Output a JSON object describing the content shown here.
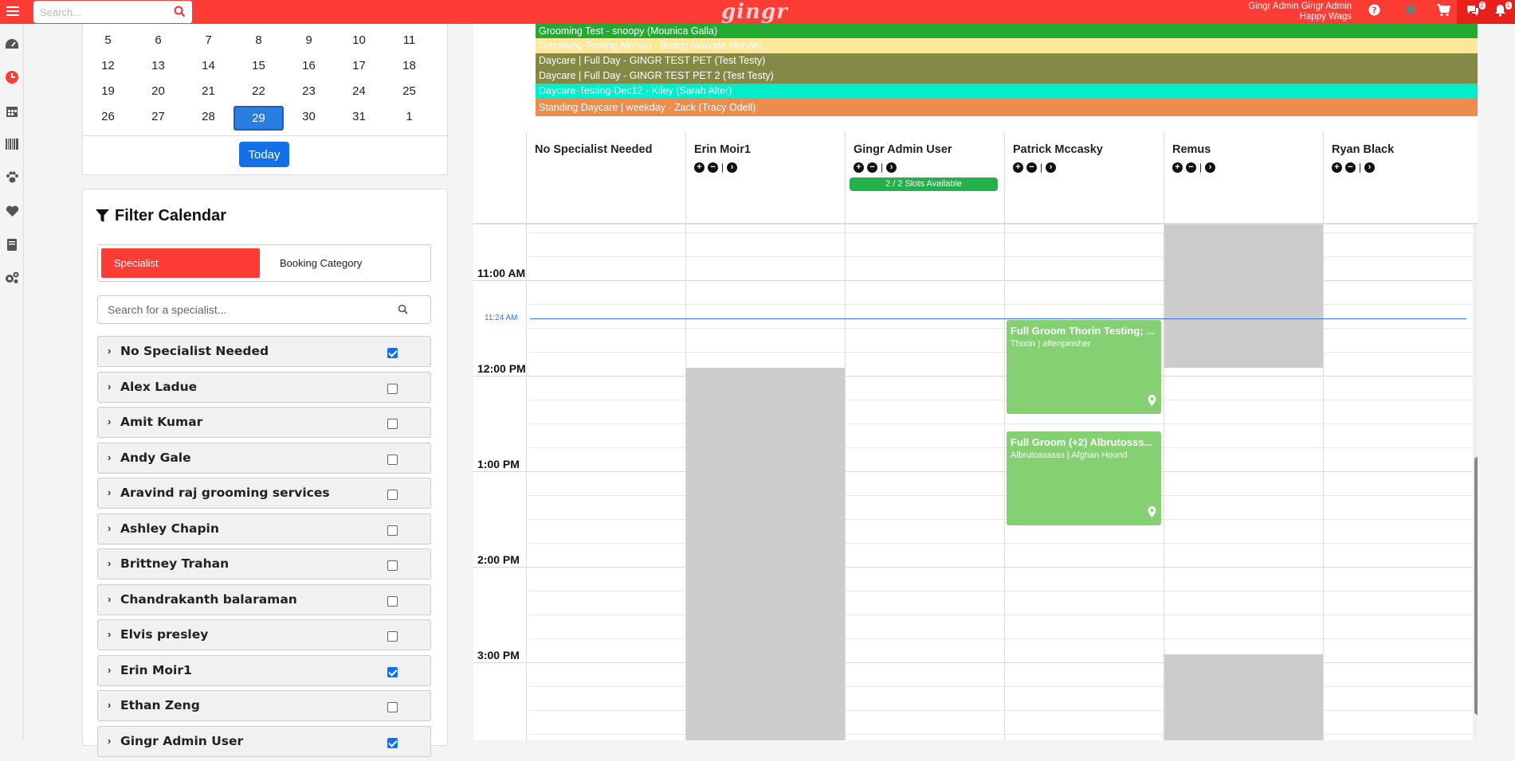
{
  "topbar": {
    "search_placeholder": "Search...",
    "logo": "gingr",
    "user_line1": "Gingr Admin Gingr Admin",
    "user_line2": "Happy Wags",
    "chat_badge": "2",
    "notif_badge": "1",
    "colors": {
      "bar": "#ff3b36"
    }
  },
  "mini_calendar": {
    "rows": [
      [
        "5",
        "6",
        "7",
        "8",
        "9",
        "10",
        "11"
      ],
      [
        "12",
        "13",
        "14",
        "15",
        "16",
        "17",
        "18"
      ],
      [
        "19",
        "20",
        "21",
        "22",
        "23",
        "24",
        "25"
      ],
      [
        "26",
        "27",
        "28",
        "29",
        "30",
        "31",
        "1"
      ]
    ],
    "selected_day": "29",
    "today_button": "Today"
  },
  "filter": {
    "title": "Filter Calendar",
    "tabs": [
      "Specialist",
      "Booking Category"
    ],
    "active_tab": "Specialist",
    "search_placeholder": "Search for a specialist...",
    "specialists": [
      {
        "name": "No Specialist Needed",
        "checked": true
      },
      {
        "name": "Alex Ladue",
        "checked": false
      },
      {
        "name": "Amit Kumar",
        "checked": false
      },
      {
        "name": "Andy Gale",
        "checked": false
      },
      {
        "name": "Aravind raj grooming services",
        "checked": false
      },
      {
        "name": "Ashley Chapin",
        "checked": false
      },
      {
        "name": "Brittney Trahan",
        "checked": false
      },
      {
        "name": "Chandrakanth balaraman",
        "checked": false
      },
      {
        "name": "Elvis presley",
        "checked": false
      },
      {
        "name": "Erin Moir1",
        "checked": true
      },
      {
        "name": "Ethan Zeng",
        "checked": false
      },
      {
        "name": "Gingr Admin User",
        "checked": true
      }
    ]
  },
  "all_day_bars": [
    {
      "label": "Grooming Test - snoopy (Mounica Galla)",
      "color": "#22aa33"
    },
    {
      "label": "Grooming-Testing-Mohan - Buddy (alavala Mohan)",
      "color": "#ffe79a",
      "text_color": "#ffffff"
    },
    {
      "label": "Daycare | Full Day - GINGR TEST PET (Test Testy)",
      "color": "#848a45"
    },
    {
      "label": "Daycare | Full Day - GINGR TEST PET 2 (Test Testy)",
      "color": "#848a45"
    },
    {
      "label": "Daycare-Testing-Dec12 - Kiley (Sarah Alter)",
      "color": "#00eecb"
    },
    {
      "label": "Standing Daycare | weekday - Zack (Tracy Odell)",
      "color": "#ec8d4e"
    }
  ],
  "columns": [
    {
      "name": "No Specialist Needed",
      "controls": false
    },
    {
      "name": "Erin Moir1",
      "controls": true
    },
    {
      "name": "Gingr Admin User",
      "controls": true,
      "slots": "2 / 2 Slots Available"
    },
    {
      "name": "Patrick Mccasky",
      "controls": true
    },
    {
      "name": "Remus",
      "controls": true
    },
    {
      "name": "Ryan Black",
      "controls": true
    }
  ],
  "time_labels": [
    "11:00 AM",
    "12:00 PM",
    "1:00 PM",
    "2:00 PM",
    "3:00 PM"
  ],
  "now_indicator": "11:24 AM",
  "appointments": [
    {
      "title": "Full Groom Thorin Testing; ...",
      "subtitle": "Thorin | affenpinsher",
      "column": "Patrick Mccasky"
    },
    {
      "title": "Full Groom (+2) Albrutosss...",
      "subtitle": "Albrutossssss | Afghan Hound",
      "column": "Patrick Mccasky"
    }
  ]
}
